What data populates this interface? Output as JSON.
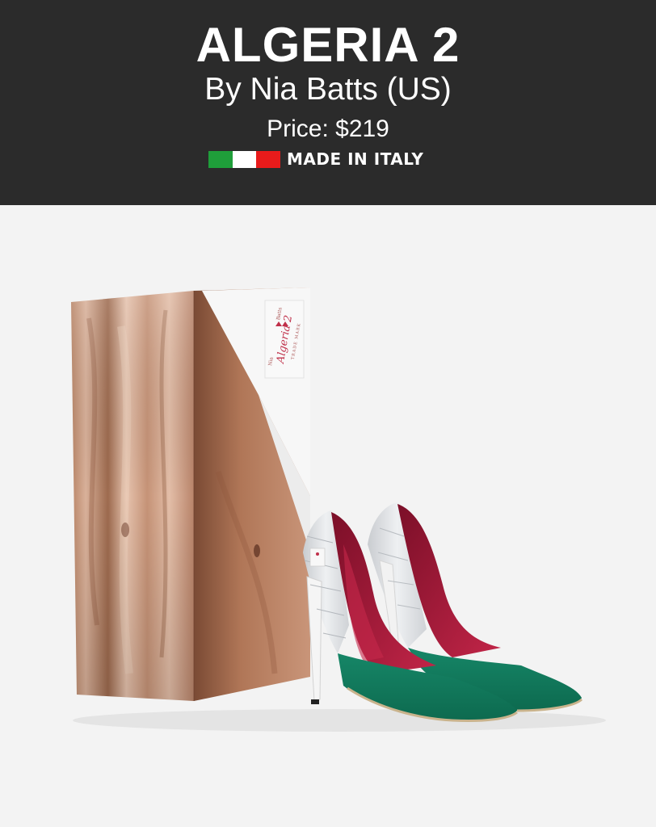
{
  "header": {
    "title": "ALGERIA 2",
    "byline": "By Nia Batts (US)",
    "price": "Price: $219",
    "made_in": "MADE IN ITALY",
    "flag_colors": [
      "#1f9e3a",
      "#ffffff",
      "#e81b1b"
    ],
    "background": "#2b2b2b"
  },
  "product_image": {
    "box_label_brand": "Algeria 2",
    "box_label_small_left": "Nia",
    "box_label_small_right": "Batts",
    "box_label_trade": "TRADE MARK",
    "shoe_colors": {
      "vamp": "#127a5c",
      "lining": "#a5193a",
      "heel_counter": "#dfe1e4"
    }
  }
}
